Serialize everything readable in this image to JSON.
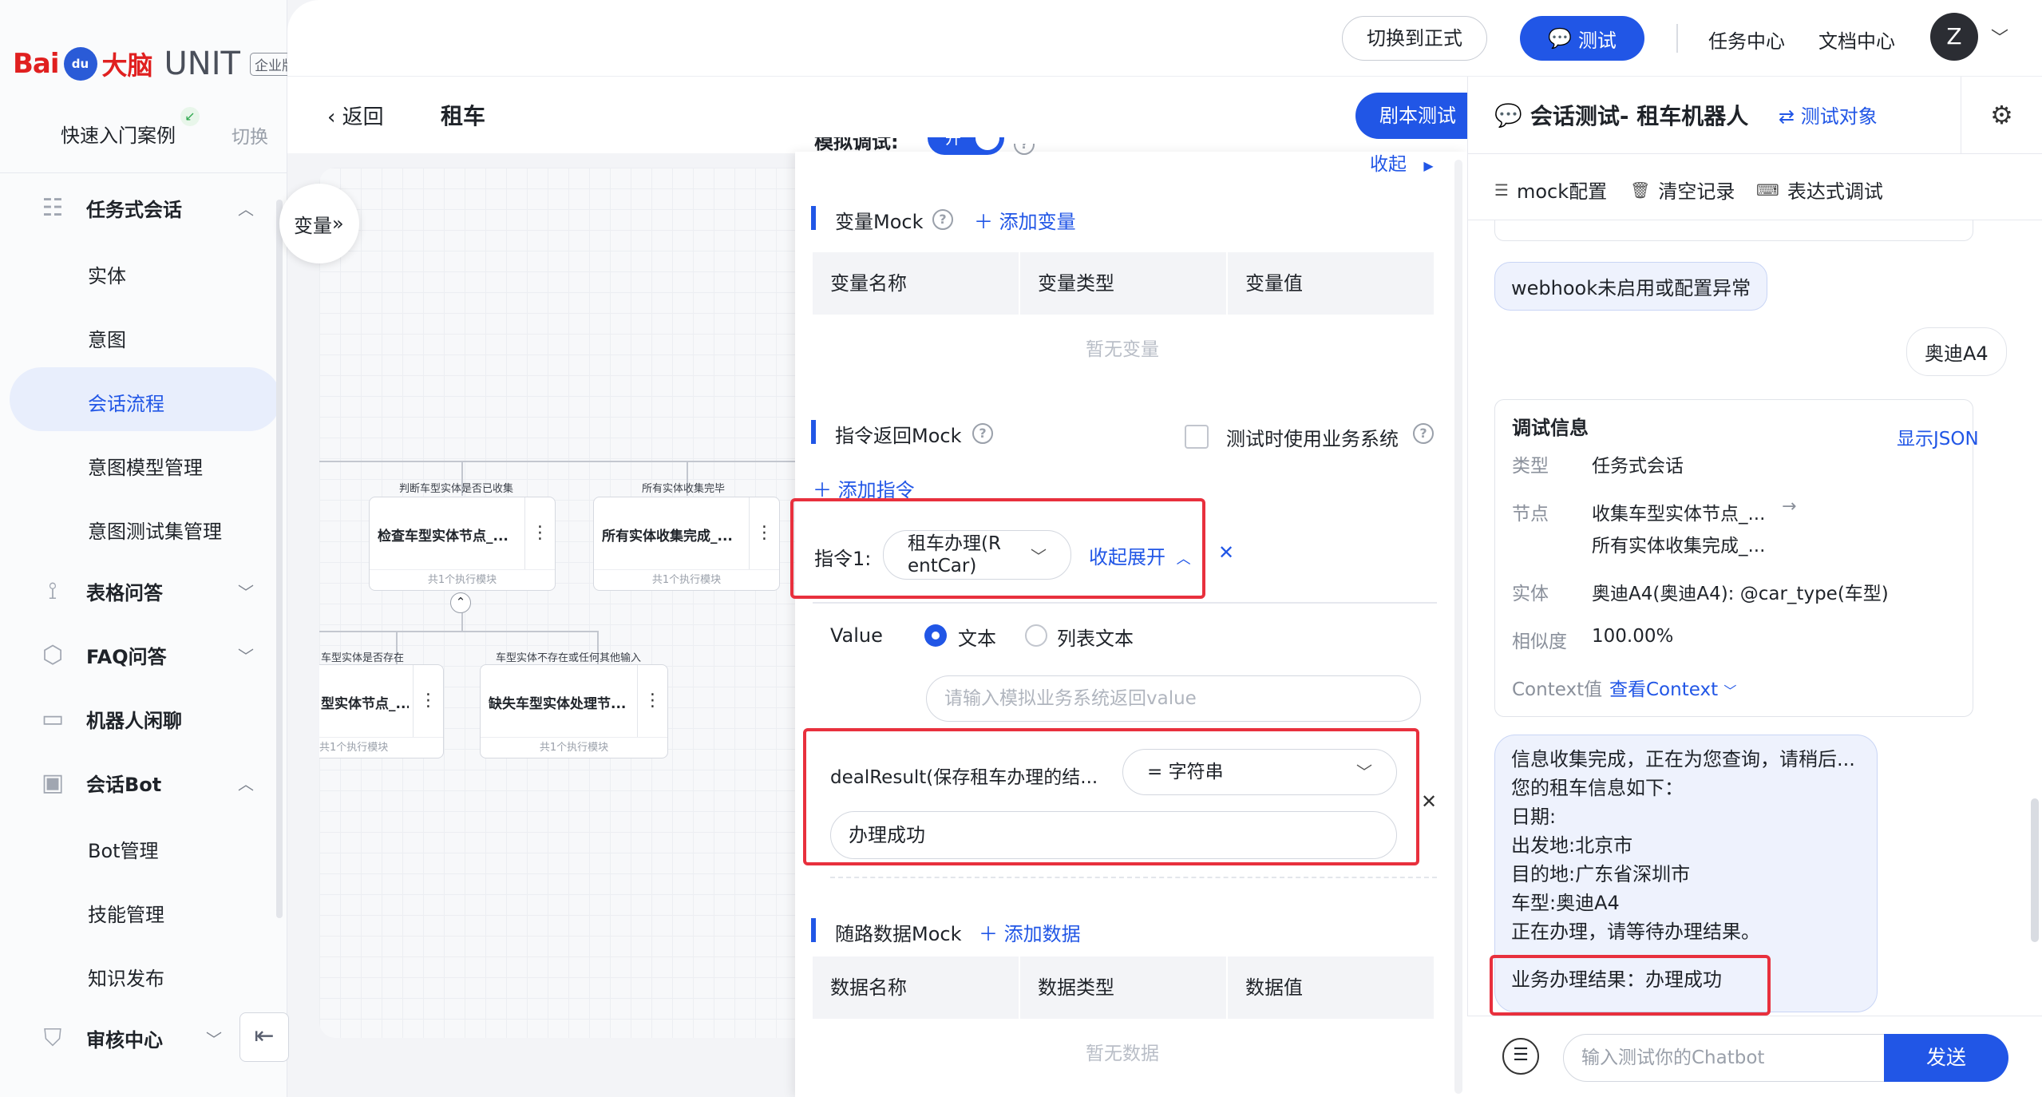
{
  "brand": {
    "logo_bai": "Bai",
    "logo_paw": "du",
    "logo_nao": "大脑",
    "logo_unit": "UNIT",
    "logo_edition": "企业版"
  },
  "sidebar": {
    "quick_start": "快速入门案例",
    "switch": "切换",
    "groups": [
      {
        "label": "任务式会话",
        "icon": "task-dialog-icon",
        "expanded": true
      },
      {
        "label": "表格问答",
        "icon": "table-qa-icon",
        "expanded": false
      },
      {
        "label": "FAQ问答",
        "icon": "faq-icon",
        "expanded": false
      },
      {
        "label": "机器人闲聊",
        "icon": "chitchat-icon",
        "expanded": false
      },
      {
        "label": "会话Bot",
        "icon": "bot-icon",
        "expanded": true
      },
      {
        "label": "审核中心",
        "icon": "shield-icon",
        "expanded": false
      }
    ],
    "task_items": [
      "实体",
      "意图",
      "会话流程",
      "意图模型管理",
      "意图测试集管理"
    ],
    "bot_items": [
      "Bot管理",
      "技能管理",
      "知识发布"
    ],
    "active_item": "会话流程"
  },
  "topbar": {
    "switch_formal": "切换到正式",
    "test": "测试",
    "task_center": "任务中心",
    "doc_center": "文档中心",
    "avatar_letter": "Z"
  },
  "page": {
    "back": "返回",
    "title": "租车",
    "script_test": "剧本测试"
  },
  "canvas": {
    "variable_toggle": "变量",
    "edges": [
      "判断车型实体是否已收集",
      "所有实体收集完毕",
      "车型实体是否存在",
      "车型实体不存在或任何其他输入"
    ],
    "nodes": [
      {
        "name": "检查车型实体节点_...",
        "sub": "共1个执行模块"
      },
      {
        "name": "所有实体收集完成_...",
        "sub": "共1个执行模块"
      },
      {
        "name": "型实体节点_...",
        "sub": "共1个执行模块"
      },
      {
        "name": "缺失车型实体处理节...",
        "sub": "共1个执行模块"
      }
    ]
  },
  "mock": {
    "sim_debug": "模拟调试:",
    "sim_toggle": "开",
    "collapse": "收起",
    "var_mock": {
      "title": "变量Mock",
      "add": "添加变量",
      "columns": [
        "变量名称",
        "变量类型",
        "变量值"
      ],
      "empty": "暂无变量"
    },
    "cmd_mock": {
      "title": "指令返回Mock",
      "use_business": "测试时使用业务系统",
      "add": "添加指令",
      "cmd_label": "指令1:",
      "cmd_value_line1": "租车办理(R",
      "cmd_value_line2": "entCar)",
      "fold_expand": "收起展开",
      "value_label": "Value",
      "radio_text": "文本",
      "radio_list": "列表文本",
      "value_placeholder": "请输入模拟业务系统返回value",
      "result_key": "dealResult(保存租车办理的结...",
      "result_type": "= 字符串",
      "result_value": "办理成功"
    },
    "data_mock": {
      "title": "随路数据Mock",
      "add": "添加数据",
      "columns": [
        "数据名称",
        "数据类型",
        "数据值"
      ],
      "empty": "暂无数据"
    }
  },
  "chat": {
    "title": "会话测试- 租车机器人",
    "target": "测试对象",
    "tools": [
      "mock配置",
      "清空记录",
      "表达式调试"
    ],
    "msg_webhook": "webhook未启用或配置异常",
    "msg_user": "奥迪A4",
    "info": {
      "title": "调试信息",
      "show_json": "显示JSON",
      "rows": [
        {
          "k": "类型",
          "v": "任务式会话"
        },
        {
          "k": "节点",
          "v": "收集车型实体节点_..."
        },
        {
          "k": "",
          "v": "所有实体收集完成_..."
        },
        {
          "k": "实体",
          "v": "奥迪A4(奥迪A4): @car_type(车型)"
        },
        {
          "k": "相似度",
          "v": "100.00%"
        }
      ],
      "context_label": "Context值",
      "context_link": "查看Context"
    },
    "reply_lines": [
      "信息收集完成，正在为您查询，请稍后...",
      "您的租车信息如下：",
      "日期:",
      "出发地:北京市",
      "目的地:广东省深圳市",
      "车型:奥迪A4",
      "正在办理，请等待办理结果。"
    ],
    "reply_result": "业务办理结果：办理成功",
    "input_placeholder": "输入测试你的Chatbot",
    "send": "发送"
  }
}
